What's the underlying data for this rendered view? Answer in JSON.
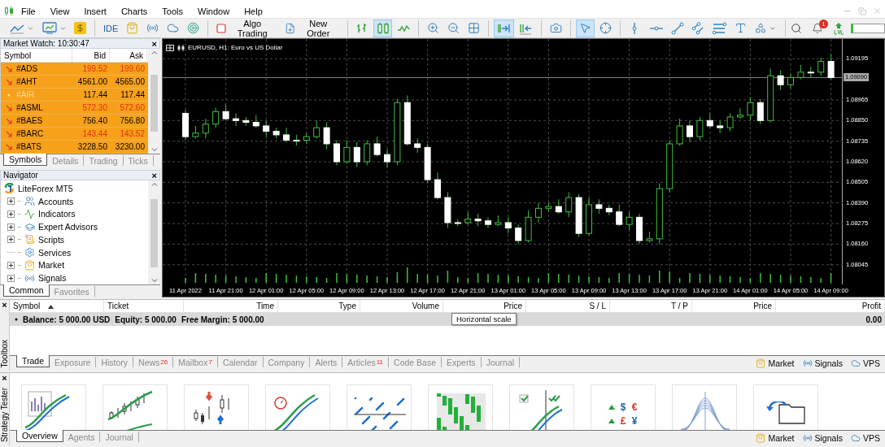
{
  "menu": [
    "File",
    "View",
    "Insert",
    "Charts",
    "Tools",
    "Window",
    "Help"
  ],
  "toolbar": {
    "ide": "IDE",
    "algo_trading": {
      "label": "Algo Trading",
      "on": false
    },
    "new_order": "New Order",
    "chart_types": [
      {
        "selected": false
      },
      {
        "selected": true
      },
      {
        "selected": false
      }
    ],
    "scroll": [
      {
        "selected": true
      },
      {
        "selected": false
      }
    ],
    "cursor_tools": [
      {
        "selected": true
      },
      {
        "selected": false
      }
    ],
    "notifications": "1"
  },
  "market_watch": {
    "title": "Market Watch: 10:30:47",
    "close": "×",
    "columns": [
      "Symbol",
      "Bid",
      "Ask"
    ],
    "rows": [
      {
        "symbol": "#ADS",
        "bid": "199.52",
        "ask": "199.60",
        "falling": true,
        "disabled": false
      },
      {
        "symbol": "#AHT",
        "bid": "4561.00",
        "ask": "4565.00",
        "falling": false,
        "disabled": false
      },
      {
        "symbol": "#AIR",
        "bid": "117.44",
        "ask": "117.44",
        "falling": false,
        "disabled": true
      },
      {
        "symbol": "#ASML",
        "bid": "572.30",
        "ask": "572.60",
        "falling": true,
        "disabled": false
      },
      {
        "symbol": "#BAES",
        "bid": "756.40",
        "ask": "756.80",
        "falling": false,
        "disabled": false
      },
      {
        "symbol": "#BARC",
        "bid": "143.44",
        "ask": "143.52",
        "falling": true,
        "disabled": false
      },
      {
        "symbol": "#BATS",
        "bid": "3228.50",
        "ask": "3230.00",
        "falling": false,
        "disabled": false
      }
    ],
    "tabs": [
      {
        "label": "Symbols",
        "selected": true
      },
      {
        "label": "Details",
        "selected": false
      },
      {
        "label": "Trading",
        "selected": false
      },
      {
        "label": "Ticks",
        "selected": false
      }
    ]
  },
  "navigator": {
    "title": "Navigator",
    "close": "×",
    "root": "LiteForex MT5",
    "items": [
      {
        "label": "Accounts",
        "kind": "group",
        "expanded": false
      },
      {
        "label": "Indicators",
        "kind": "group",
        "expanded": false
      },
      {
        "label": "Expert Advisors",
        "kind": "group",
        "expanded": false
      },
      {
        "label": "Scripts",
        "kind": "group",
        "expanded": false
      },
      {
        "label": "Services",
        "kind": "leaf"
      },
      {
        "label": "Market",
        "kind": "group",
        "expanded": false
      },
      {
        "label": "Signals",
        "kind": "group",
        "expanded": false
      }
    ],
    "tabs": [
      {
        "label": "Common",
        "selected": true
      },
      {
        "label": "Favorites",
        "selected": false
      }
    ]
  },
  "chart": {
    "title": "EURUSD, H1:  Euro vs US Dollar",
    "chart_data": {
      "type": "candlestick",
      "ylim": [
        1.07935,
        1.09305
      ],
      "yticks": [
        {
          "value": 1.09195,
          "label": "1.09195"
        },
        {
          "value": 1.08965,
          "label": "1.08965"
        },
        {
          "value": 1.0885,
          "label": "1.08850"
        },
        {
          "value": 1.08735,
          "label": "1.08735"
        },
        {
          "value": 1.0862,
          "label": "1.08620"
        },
        {
          "value": 1.08505,
          "label": "1.08505"
        },
        {
          "value": 1.0839,
          "label": "1.08390"
        },
        {
          "value": 1.08275,
          "label": "1.08275"
        },
        {
          "value": 1.0816,
          "label": "1.08160"
        },
        {
          "value": 1.08045,
          "label": "1.08045"
        }
      ],
      "grid": true,
      "ref_lines": [
        {
          "axis": "y",
          "value": 1.0909,
          "label": "1.09090"
        }
      ],
      "categories": [
        "11 Apr 2022",
        null,
        null,
        null,
        "11 Apr 21:00",
        null,
        null,
        null,
        "12 Apr 01:00",
        null,
        null,
        null,
        "12 Apr 05:00",
        null,
        null,
        null,
        "12 Apr 09:00",
        null,
        null,
        null,
        "12 Apr 13:00",
        null,
        null,
        null,
        "12 Apr 17:00",
        null,
        null,
        null,
        "12 Apr 21:00",
        null,
        null,
        null,
        "13 Apr 01:00",
        null,
        null,
        null,
        "13 Apr 05:00",
        null,
        null,
        null,
        "13 Apr 09:00",
        null,
        null,
        null,
        "13 Apr 13:00",
        null,
        null,
        null,
        "13 Apr 17:00",
        null,
        null,
        null,
        "13 Apr 21:00",
        null,
        null,
        null,
        "14 Apr 01:00",
        null,
        null,
        null,
        "14 Apr 05:00",
        null,
        null,
        null,
        "14 Apr 09:00"
      ],
      "ohlc": [
        [
          1.0889,
          1.0891,
          1.0874,
          1.0876
        ],
        [
          1.0876,
          1.0882,
          1.0875,
          1.0878
        ],
        [
          1.0878,
          1.0886,
          1.0875,
          1.0883
        ],
        [
          1.0883,
          1.0892,
          1.0881,
          1.089
        ],
        [
          1.089,
          1.0894,
          1.0885,
          1.0886
        ],
        [
          1.0886,
          1.0889,
          1.0882,
          1.0885
        ],
        [
          1.0885,
          1.0887,
          1.0882,
          1.0884
        ],
        [
          1.0884,
          1.0888,
          1.0881,
          1.0882
        ],
        [
          1.0882,
          1.0885,
          1.0876,
          1.0879
        ],
        [
          1.0879,
          1.0881,
          1.0875,
          1.0877
        ],
        [
          1.0877,
          1.0881,
          1.0873,
          1.0874
        ],
        [
          1.0874,
          1.0877,
          1.0871,
          1.0874
        ],
        [
          1.0874,
          1.0878,
          1.0872,
          1.0876
        ],
        [
          1.0876,
          1.0885,
          1.0875,
          1.0881
        ],
        [
          1.0881,
          1.0884,
          1.0869,
          1.0872
        ],
        [
          1.0872,
          1.0874,
          1.086,
          1.0862
        ],
        [
          1.0862,
          1.0874,
          1.0861,
          1.087
        ],
        [
          1.087,
          1.0873,
          1.0859,
          1.0862
        ],
        [
          1.0862,
          1.0874,
          1.086,
          1.0872
        ],
        [
          1.0872,
          1.0876,
          1.0865,
          1.0866
        ],
        [
          1.0866,
          1.0869,
          1.0859,
          1.0862
        ],
        [
          1.0862,
          1.0897,
          1.086,
          1.0895
        ],
        [
          1.0895,
          1.0899,
          1.0871,
          1.0872
        ],
        [
          1.0872,
          1.0875,
          1.0867,
          1.087
        ],
        [
          1.087,
          1.0872,
          1.085,
          1.0852
        ],
        [
          1.0852,
          1.0856,
          1.0841,
          1.0842
        ],
        [
          1.0842,
          1.0845,
          1.0825,
          1.0828
        ],
        [
          1.0828,
          1.083,
          1.0826,
          1.0828
        ],
        [
          1.0828,
          1.0834,
          1.0827,
          1.083
        ],
        [
          1.083,
          1.0833,
          1.0826,
          1.0829
        ],
        [
          1.0829,
          1.0831,
          1.0825,
          1.0827
        ],
        [
          1.0827,
          1.0832,
          1.0826,
          1.0828
        ],
        [
          1.0828,
          1.0831,
          1.0822,
          1.0825
        ],
        [
          1.0825,
          1.0827,
          1.0816,
          1.0818
        ],
        [
          1.0818,
          1.0835,
          1.0817,
          1.0831
        ],
        [
          1.0831,
          1.0839,
          1.0828,
          1.0836
        ],
        [
          1.0836,
          1.0839,
          1.0834,
          1.0837
        ],
        [
          1.0837,
          1.0841,
          1.0833,
          1.0834
        ],
        [
          1.0834,
          1.0845,
          1.0831,
          1.0842
        ],
        [
          1.0842,
          1.0844,
          1.082,
          1.0822
        ],
        [
          1.0822,
          1.0842,
          1.0821,
          1.0838
        ],
        [
          1.0838,
          1.0841,
          1.0833,
          1.0836
        ],
        [
          1.0836,
          1.0838,
          1.0832,
          1.0834
        ],
        [
          1.0834,
          1.0838,
          1.0826,
          1.0827
        ],
        [
          1.0827,
          1.0834,
          1.0824,
          1.0831
        ],
        [
          1.0831,
          1.0833,
          1.0816,
          1.0818
        ],
        [
          1.0818,
          1.0823,
          1.0817,
          1.0819
        ],
        [
          1.0819,
          1.085,
          1.0816,
          1.0847
        ],
        [
          1.0847,
          1.0874,
          1.0845,
          1.0872
        ],
        [
          1.0872,
          1.0886,
          1.0871,
          1.0882
        ],
        [
          1.0882,
          1.0885,
          1.0873,
          1.0876
        ],
        [
          1.0876,
          1.0887,
          1.0874,
          1.0885
        ],
        [
          1.0885,
          1.0889,
          1.0881,
          1.0882
        ],
        [
          1.0882,
          1.0885,
          1.0878,
          1.0881
        ],
        [
          1.0881,
          1.0889,
          1.0879,
          1.0887
        ],
        [
          1.0887,
          1.0892,
          1.0886,
          1.0888
        ],
        [
          1.0888,
          1.0898,
          1.0885,
          1.0895
        ],
        [
          1.0895,
          1.0897,
          1.0883,
          1.0885
        ],
        [
          1.0885,
          1.0914,
          1.0884,
          1.091
        ],
        [
          1.091,
          1.0913,
          1.0902,
          1.0905
        ],
        [
          1.0905,
          1.0911,
          1.0903,
          1.0909
        ],
        [
          1.0909,
          1.0916,
          1.0908,
          1.0912
        ],
        [
          1.0912,
          1.0915,
          1.0909,
          1.0912
        ],
        [
          1.0912,
          1.092,
          1.091,
          1.0918
        ],
        [
          1.0918,
          1.0922,
          1.0908,
          1.0909
        ]
      ]
    }
  },
  "toolbox": {
    "close": "×",
    "side_label": "Toolbox",
    "columns": [
      "Symbol",
      "Ticket",
      "Time",
      "Type",
      "Volume",
      "Price",
      "S / L",
      "T / P",
      "Price",
      "Profit"
    ],
    "balance": [
      "Balance: 5 000.00 USD",
      "Equity: 5 000.00",
      "Free Margin: 5 000.00"
    ],
    "profit": "0.00",
    "tooltip": "Horizontal scale",
    "tabs": [
      {
        "label": "Trade",
        "selected": true
      },
      {
        "label": "Exposure",
        "selected": false
      },
      {
        "label": "History",
        "selected": false
      },
      {
        "label": "News",
        "badge": "26",
        "selected": false
      },
      {
        "label": "Mailbox",
        "badge": "7",
        "selected": false
      },
      {
        "label": "Calendar",
        "selected": false
      },
      {
        "label": "Company",
        "selected": false
      },
      {
        "label": "Alerts",
        "selected": false
      },
      {
        "label": "Articles",
        "badge": "11",
        "selected": false
      },
      {
        "label": "Code Base",
        "selected": false
      },
      {
        "label": "Experts",
        "selected": false
      },
      {
        "label": "Journal",
        "selected": false
      }
    ],
    "links": [
      "Market",
      "Signals",
      "VPS"
    ]
  },
  "strategy_tester": {
    "close": "×",
    "side_label": "Strategy Tester",
    "currency_symbols": [
      "$",
      "€",
      "£",
      "¥"
    ],
    "tabs": [
      {
        "label": "Overview",
        "selected": true
      },
      {
        "label": "Agents",
        "selected": false
      },
      {
        "label": "Journal",
        "selected": false
      }
    ],
    "links": [
      "Market",
      "Signals",
      "VPS"
    ]
  }
}
